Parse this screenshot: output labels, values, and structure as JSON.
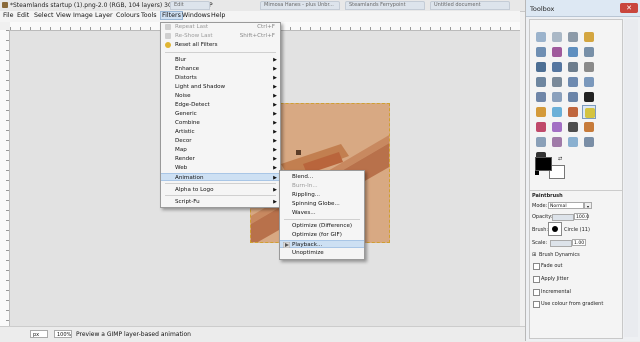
{
  "window": {
    "title": "*Steamlands startup (1).png-2.0 (RGB, 104 layers) 300x298 – GIMP",
    "background_tabs": [
      "Edit",
      "Mimosa Hanes - plus Unbr...",
      "Steamlands Ferrypoint",
      "Untitled document"
    ]
  },
  "menubar": {
    "items": [
      "File",
      "Edit",
      "Select",
      "View",
      "Image",
      "Layer",
      "Colours",
      "Tools",
      "Filters",
      "Windows",
      "Help"
    ],
    "active": "Filters"
  },
  "filters_menu": {
    "items": [
      {
        "label": "Repeat Last",
        "shortcut": "Ctrl+F",
        "disabled": true,
        "icon": "repeat-icon"
      },
      {
        "label": "Re-Show Last",
        "shortcut": "Shift+Ctrl+F",
        "disabled": true,
        "icon": "reshow-icon"
      },
      {
        "label": "Reset all Filters",
        "shortcut": "",
        "disabled": false,
        "icon": "reset-icon"
      },
      {
        "label": "Blur",
        "submenu": true
      },
      {
        "label": "Enhance",
        "submenu": true
      },
      {
        "label": "Distorts",
        "submenu": true
      },
      {
        "label": "Light and Shadow",
        "submenu": true
      },
      {
        "label": "Noise",
        "submenu": true
      },
      {
        "label": "Edge-Detect",
        "submenu": true
      },
      {
        "label": "Generic",
        "submenu": true
      },
      {
        "label": "Combine",
        "submenu": true
      },
      {
        "label": "Artistic",
        "submenu": true
      },
      {
        "label": "Decor",
        "submenu": true
      },
      {
        "label": "Map",
        "submenu": true
      },
      {
        "label": "Render",
        "submenu": true
      },
      {
        "label": "Web",
        "submenu": true
      },
      {
        "label": "Animation",
        "submenu": true,
        "highlighted": true
      },
      {
        "label": "Alpha to Logo",
        "submenu": true
      },
      {
        "label": "Script-Fu",
        "submenu": true
      }
    ]
  },
  "animation_menu": {
    "items": [
      {
        "label": "Blend..."
      },
      {
        "label": "Burn-In...",
        "disabled": true
      },
      {
        "label": "Rippling..."
      },
      {
        "label": "Spinning Globe..."
      },
      {
        "label": "Waves..."
      },
      {
        "label": "Optimize (Difference)"
      },
      {
        "label": "Optimize (for GIF)"
      },
      {
        "label": "Playback...",
        "highlighted": true
      },
      {
        "label": "Unoptimize"
      }
    ]
  },
  "statusbar": {
    "unit": "px",
    "zoom": "100%",
    "message": "Preview a GIMP layer-based animation"
  },
  "toolbox": {
    "title": "Toolbox",
    "close_label": "✕",
    "tool_icons": [
      "rect-select-icon",
      "ellipse-select-icon",
      "lasso-icon",
      "fuzzy-select-icon",
      "color-select-icon",
      "scissors-icon",
      "foreground-select-icon",
      "paths-icon",
      "color-picker-icon",
      "zoom-icon",
      "measure-icon",
      "move-icon",
      "align-icon",
      "crop-icon",
      "rotate-icon",
      "scale-icon",
      "shear-icon",
      "perspective-icon",
      "flip-icon",
      "text-icon",
      "bucket-fill-icon",
      "blend-icon",
      "pencil-icon",
      "paintbrush-icon",
      "eraser-icon",
      "airbrush-icon",
      "ink-icon",
      "clone-icon",
      "heal-icon",
      "perspective-clone-icon",
      "blur-icon",
      "smudge-icon",
      "dodge-icon"
    ],
    "selected_tool": "paintbrush-icon",
    "options": {
      "heading": "Paintbrush",
      "mode_label": "Mode:",
      "mode_value": "Normal",
      "opacity_label": "Opacity:",
      "opacity_value": "100.0",
      "brush_label": "Brush:",
      "brush_value": "Circle (11)",
      "scale_label": "Scale:",
      "scale_value": "1.00",
      "brush_dynamics": "Brush Dynamics",
      "fade_out": "Fade out",
      "apply_jitter": "Apply Jitter",
      "incremental": "Incremental",
      "use_colour": "Use colour from gradient"
    }
  },
  "colors": {
    "image_bg": "#d8a983",
    "menu_highlight": "#cde0f3",
    "foreground": "#000000",
    "background": "#ffffff"
  }
}
